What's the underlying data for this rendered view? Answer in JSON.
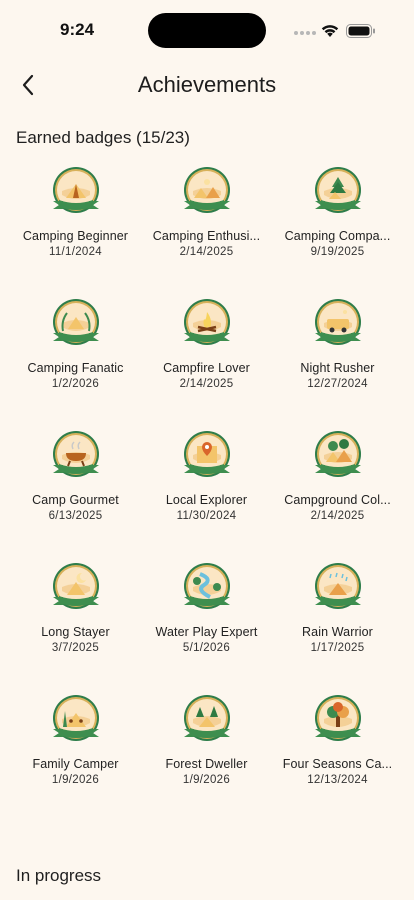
{
  "status_bar": {
    "time": "9:24"
  },
  "header": {
    "title": "Achievements"
  },
  "earned": {
    "title": "Earned badges (15/23)",
    "badges": [
      {
        "name": "Camping Beginner",
        "date": "11/1/2024",
        "icon": "tent-icon"
      },
      {
        "name": "Camping Enthusi...",
        "date": "2/14/2025",
        "icon": "tents-icon"
      },
      {
        "name": "Camping Compa...",
        "date": "9/19/2025",
        "icon": "tree-tent-icon"
      },
      {
        "name": "Camping Fanatic",
        "date": "1/2/2026",
        "icon": "laurel-tent-icon"
      },
      {
        "name": "Campfire Lover",
        "date": "2/14/2025",
        "icon": "campfire-icon"
      },
      {
        "name": "Night Rusher",
        "date": "12/27/2024",
        "icon": "camper-van-icon"
      },
      {
        "name": "Camp Gourmet",
        "date": "6/13/2025",
        "icon": "grill-icon"
      },
      {
        "name": "Local Explorer",
        "date": "11/30/2024",
        "icon": "map-pin-icon"
      },
      {
        "name": "Campground Col...",
        "date": "2/14/2025",
        "icon": "campground-icon"
      },
      {
        "name": "Long Stayer",
        "date": "3/7/2025",
        "icon": "moon-tent-icon"
      },
      {
        "name": "Water Play Expert",
        "date": "5/1/2026",
        "icon": "river-icon"
      },
      {
        "name": "Rain Warrior",
        "date": "1/17/2025",
        "icon": "rain-tent-icon"
      },
      {
        "name": "Family Camper",
        "date": "1/9/2026",
        "icon": "family-tent-icon"
      },
      {
        "name": "Forest Dweller",
        "date": "1/9/2026",
        "icon": "forest-tent-icon"
      },
      {
        "name": "Four Seasons Ca...",
        "date": "12/13/2024",
        "icon": "four-seasons-tree-icon"
      }
    ]
  },
  "in_progress": {
    "title": "In progress"
  },
  "colors": {
    "background": "#fdf7ef",
    "badge_green": "#2e7d4a",
    "badge_orange": "#e08a2e",
    "badge_ribbon": "#3e8e4f"
  }
}
